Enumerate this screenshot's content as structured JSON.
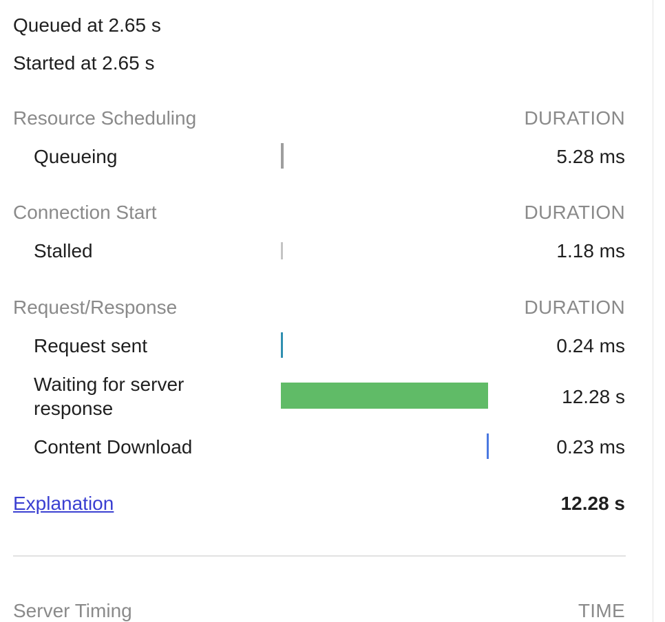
{
  "queued": "Queued at 2.65 s",
  "started": "Started at 2.65 s",
  "sections": {
    "scheduling": {
      "title": "Resource Scheduling",
      "header": "DURATION",
      "rows": [
        {
          "label": "Queueing",
          "value": "5.28 ms",
          "color": "#9e9e9e"
        }
      ]
    },
    "connection": {
      "title": "Connection Start",
      "header": "DURATION",
      "rows": [
        {
          "label": "Stalled",
          "value": "1.18 ms",
          "color": "#c4c4c4"
        }
      ]
    },
    "request": {
      "title": "Request/Response",
      "header": "DURATION",
      "rows": [
        {
          "label": "Request sent",
          "value": "0.24 ms",
          "color": "#2f8fb0"
        },
        {
          "label": "Waiting for server response",
          "value": "12.28 s",
          "color": "#60bb67"
        },
        {
          "label": "Content Download",
          "value": "0.23 ms",
          "color": "#4a78e0"
        }
      ]
    }
  },
  "explanation": {
    "label": "Explanation",
    "total": "12.28 s"
  },
  "server_timing": {
    "title": "Server Timing",
    "header": "TIME"
  }
}
